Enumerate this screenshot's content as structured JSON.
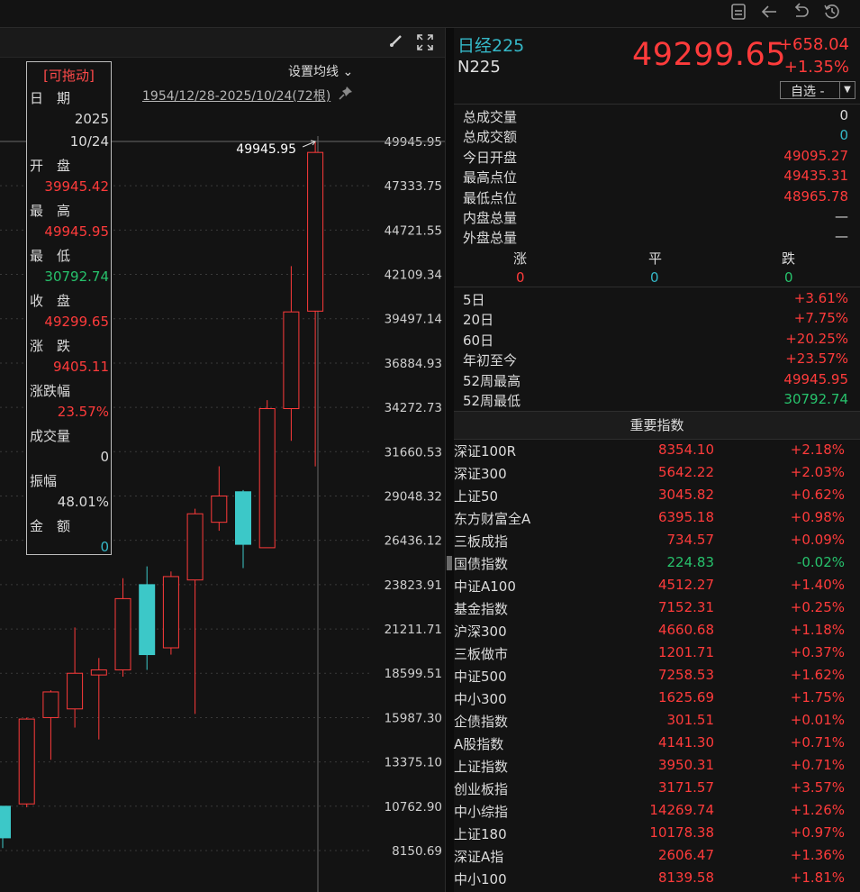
{
  "toolbar": {
    "icons": [
      "note-icon",
      "back-arrow-icon",
      "undo-icon",
      "history-icon"
    ]
  },
  "chart": {
    "set_ma": "设置均线",
    "range": "1954/12/28-2025/10/24(72根)",
    "draggable": "[可拖动]",
    "high_mark": "49945.95",
    "y_ticks": [
      "49945.95",
      "47333.75",
      "44721.55",
      "42109.34",
      "39497.14",
      "36884.93",
      "34272.73",
      "31660.53",
      "29048.32",
      "26436.12",
      "23823.91",
      "21211.71",
      "18599.51",
      "15987.30",
      "13375.10",
      "10762.90",
      "8150.69"
    ],
    "info": {
      "date_label": "日　期",
      "date_year": "2025",
      "date_md": "10/24",
      "open_label": "开　盘",
      "open": "39945.42",
      "high_label": "最　高",
      "high": "49945.95",
      "low_label": "最　低",
      "low": "30792.74",
      "close_label": "收　盘",
      "close": "49299.65",
      "chg_label": "涨　跌",
      "chg": "9405.11",
      "pct_label": "涨跌幅",
      "pct": "23.57%",
      "vol_label": "成交量",
      "vol": "0",
      "amp_label": "振幅",
      "amp": "48.01%",
      "amt_label": "金　额",
      "amt": "0"
    }
  },
  "chart_data": {
    "type": "candlestick",
    "ylim": [
      8150.69,
      49945.95
    ],
    "candles": [
      {
        "o": 10762.9,
        "h": 10762.9,
        "l": 8300,
        "c": 8900,
        "up": false
      },
      {
        "o": 10900,
        "h": 15987.3,
        "l": 10700,
        "c": 15900,
        "up": true
      },
      {
        "o": 15987.3,
        "h": 17600,
        "l": 13500,
        "c": 17500,
        "up": true
      },
      {
        "o": 16500,
        "h": 21300,
        "l": 15400,
        "c": 18600,
        "up": true
      },
      {
        "o": 18500,
        "h": 19500,
        "l": 14700,
        "c": 18800,
        "up": true
      },
      {
        "o": 18800,
        "h": 24200,
        "l": 18400,
        "c": 23000,
        "up": true
      },
      {
        "o": 23823.91,
        "h": 24900,
        "l": 18800,
        "c": 19700,
        "up": false
      },
      {
        "o": 20100,
        "h": 24600,
        "l": 19700,
        "c": 24300,
        "up": true
      },
      {
        "o": 24100,
        "h": 28300,
        "l": 16200,
        "c": 28000,
        "up": true
      },
      {
        "o": 27500,
        "h": 30800,
        "l": 27000,
        "c": 29048.32,
        "up": true
      },
      {
        "o": 29300,
        "h": 29400,
        "l": 24800,
        "c": 26200,
        "up": false
      },
      {
        "o": 26000,
        "h": 34700,
        "l": 26000,
        "c": 34200,
        "up": true
      },
      {
        "o": 34200,
        "h": 42600,
        "l": 32300,
        "c": 39900,
        "up": true
      },
      {
        "o": 39945.42,
        "h": 49945.95,
        "l": 30792.74,
        "c": 49299.65,
        "up": true
      }
    ]
  },
  "quote": {
    "name": "日经225",
    "code": "N225",
    "price": "49299.65",
    "change": "+658.04",
    "change_pct": "+1.35%",
    "select_label": "自选 -",
    "stats": [
      {
        "label": "总成交量",
        "value": "0",
        "color": "white"
      },
      {
        "label": "总成交额",
        "value": "0",
        "color": "cyan"
      },
      {
        "label": "今日开盘",
        "value": "49095.27",
        "color": "red"
      },
      {
        "label": "最高点位",
        "value": "49435.31",
        "color": "red"
      },
      {
        "label": "最低点位",
        "value": "48965.78",
        "color": "red"
      },
      {
        "label": "内盘总量",
        "value": "—",
        "color": "white"
      },
      {
        "label": "外盘总量",
        "value": "—",
        "color": "white"
      }
    ],
    "breadth": {
      "up_label": "涨",
      "flat_label": "平",
      "down_label": "跌",
      "up": "0",
      "flat": "0",
      "down": "0"
    },
    "periods": [
      {
        "label": "5日",
        "value": "+3.61%"
      },
      {
        "label": "20日",
        "value": "+7.75%"
      },
      {
        "label": "60日",
        "value": "+20.25%"
      },
      {
        "label": "年初至今",
        "value": "+23.57%"
      },
      {
        "label": "52周最高",
        "value": "49945.95"
      },
      {
        "label": "52周最低",
        "value": "30792.74"
      }
    ],
    "index_title": "重要指数",
    "indices": [
      {
        "name": "深证100R",
        "value": "8354.10",
        "pct": "+2.18%",
        "color": "red"
      },
      {
        "name": "深证300",
        "value": "5642.22",
        "pct": "+2.03%",
        "color": "red"
      },
      {
        "name": "上证50",
        "value": "3045.82",
        "pct": "+0.62%",
        "color": "red"
      },
      {
        "name": "东方财富全A",
        "value": "6395.18",
        "pct": "+0.98%",
        "color": "red"
      },
      {
        "name": "三板成指",
        "value": "734.57",
        "pct": "+0.09%",
        "color": "red"
      },
      {
        "name": "国债指数",
        "value": "224.83",
        "pct": "-0.02%",
        "color": "green"
      },
      {
        "name": "中证A100",
        "value": "4512.27",
        "pct": "+1.40%",
        "color": "red"
      },
      {
        "name": "基金指数",
        "value": "7152.31",
        "pct": "+0.25%",
        "color": "red"
      },
      {
        "name": "沪深300",
        "value": "4660.68",
        "pct": "+1.18%",
        "color": "red"
      },
      {
        "name": "三板做市",
        "value": "1201.71",
        "pct": "+0.37%",
        "color": "red"
      },
      {
        "name": "中证500",
        "value": "7258.53",
        "pct": "+1.62%",
        "color": "red"
      },
      {
        "name": "中小300",
        "value": "1625.69",
        "pct": "+1.75%",
        "color": "red"
      },
      {
        "name": "企债指数",
        "value": "301.51",
        "pct": "+0.01%",
        "color": "red"
      },
      {
        "name": "A股指数",
        "value": "4141.30",
        "pct": "+0.71%",
        "color": "red"
      },
      {
        "name": "上证指数",
        "value": "3950.31",
        "pct": "+0.71%",
        "color": "red"
      },
      {
        "name": "创业板指",
        "value": "3171.57",
        "pct": "+3.57%",
        "color": "red"
      },
      {
        "name": "中小综指",
        "value": "14269.74",
        "pct": "+1.26%",
        "color": "red"
      },
      {
        "name": "上证180",
        "value": "10178.38",
        "pct": "+0.97%",
        "color": "red"
      },
      {
        "name": "深证A指",
        "value": "2606.47",
        "pct": "+1.36%",
        "color": "red"
      },
      {
        "name": "中小100",
        "value": "8139.58",
        "pct": "+1.81%",
        "color": "red"
      }
    ]
  }
}
